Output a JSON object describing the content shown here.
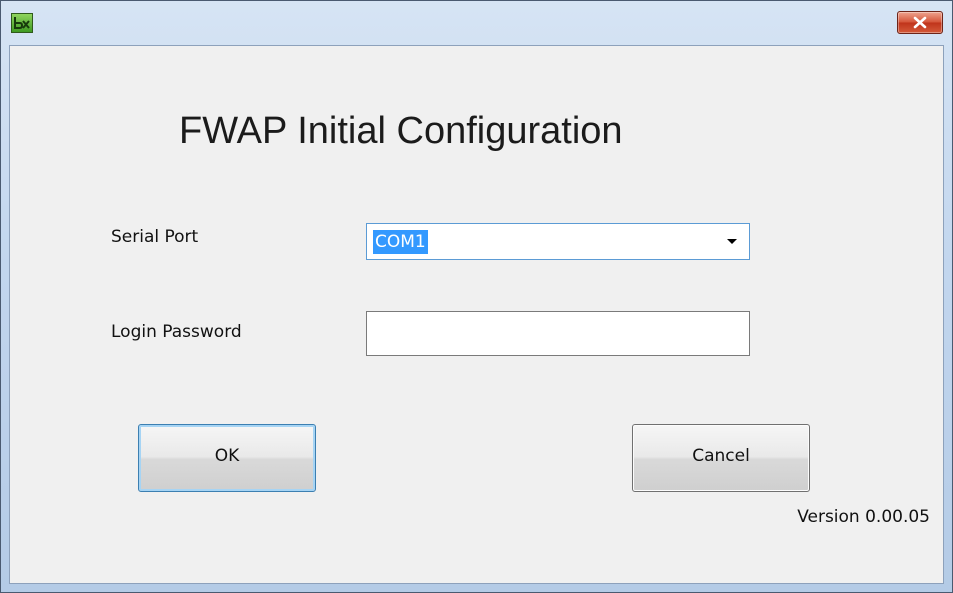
{
  "window": {
    "title": "",
    "app_icon": "bx-app-icon",
    "close_icon": "close-x-icon"
  },
  "dialog": {
    "heading": "FWAP Initial Configuration",
    "serial_port": {
      "label": "Serial Port",
      "selected": "COM1",
      "arrow_icon": "chevron-down-icon"
    },
    "login_password": {
      "label": "Login Password",
      "value": "",
      "placeholder": ""
    },
    "buttons": {
      "ok_label": "OK",
      "cancel_label": "Cancel"
    },
    "version": "Version 0.00.05"
  },
  "colors": {
    "titlebar": "#c2d6ee",
    "client_background": "#f0f0f0",
    "selection": "#3399ff",
    "close_button": "#c8402a",
    "focus_border": "#3c7fb1"
  }
}
